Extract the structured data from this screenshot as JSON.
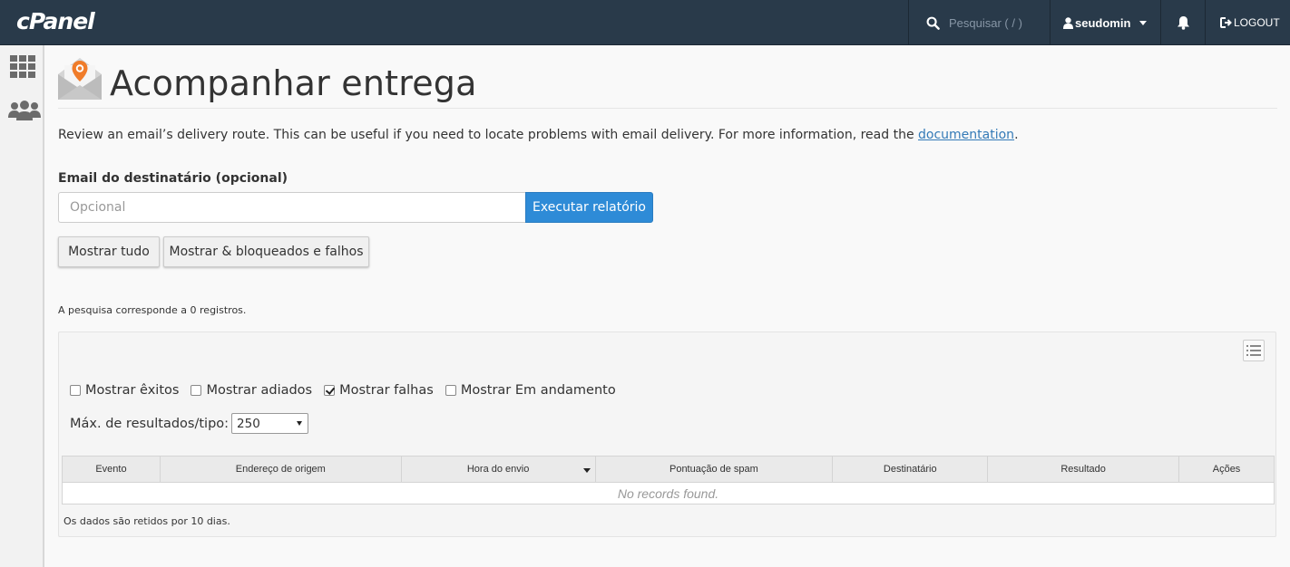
{
  "topbar": {
    "logo": "cPanel",
    "search_placeholder": "Pesquisar ( / )",
    "username": "seudomin",
    "logout_label": "LOGOUT"
  },
  "sidebar": {
    "items": [
      {
        "icon": "grid-icon"
      },
      {
        "icon": "users-icon"
      }
    ]
  },
  "page": {
    "title": "Acompanhar entrega",
    "description": "Review an email’s delivery route. This can be useful if you need to locate problems with email delivery. For more information, read the ",
    "doc_link": "documentation",
    "description_end": "."
  },
  "form": {
    "label": "Email do destinatário (opcional)",
    "placeholder": "Opcional",
    "run_label": "Executar relatório",
    "show_all_label": "Mostrar tudo",
    "show_blocked_label": "Mostrar & bloqueados e falhos"
  },
  "results": {
    "match_text": "A pesquisa corresponde a 0 registros.",
    "filters": [
      {
        "label": "Mostrar êxitos",
        "checked": false
      },
      {
        "label": "Mostrar adiados",
        "checked": false
      },
      {
        "label": "Mostrar falhas",
        "checked": true
      },
      {
        "label": "Mostrar Em andamento",
        "checked": false
      }
    ],
    "max_label": "Máx. de resultados/tipo:",
    "max_value": "250",
    "columns": [
      "Evento",
      "Endereço de origem",
      "Hora do envio",
      "Pontuação de spam",
      "Destinatário",
      "Resultado",
      "Ações"
    ],
    "empty_text": "No records found.",
    "footnote": "Os dados são retidos por 10 dias."
  },
  "colors": {
    "topbar": "#293a4a",
    "primary": "#2e8bd7",
    "link": "#337ab7"
  }
}
